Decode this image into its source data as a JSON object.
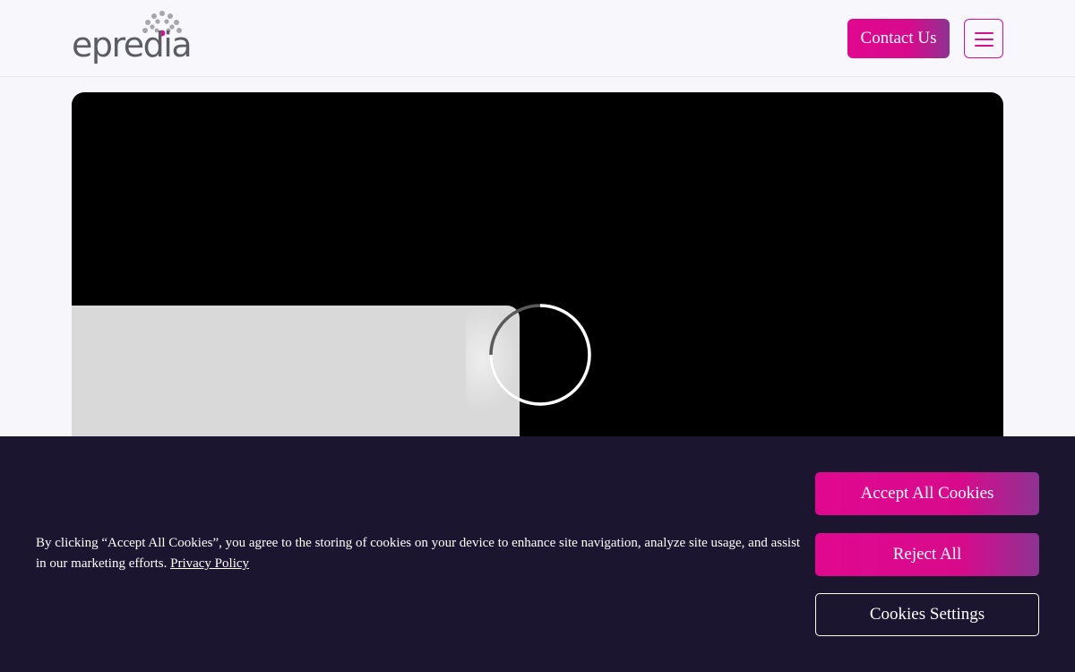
{
  "header": {
    "logo_text": "epredia",
    "contact_label": "Contact Us"
  },
  "colors": {
    "brand": "#d4118f",
    "banner": "#1b1530"
  },
  "cookie_banner": {
    "text": "By clicking “Accept All Cookies”, you agree to the storing of cookies on your device to enhance site navigation, analyze site usage, and assist in our marketing efforts.",
    "privacy_link": "Privacy Policy",
    "accept_label": "Accept All Cookies",
    "reject_label": "Reject All",
    "settings_label": "Cookies Settings"
  }
}
